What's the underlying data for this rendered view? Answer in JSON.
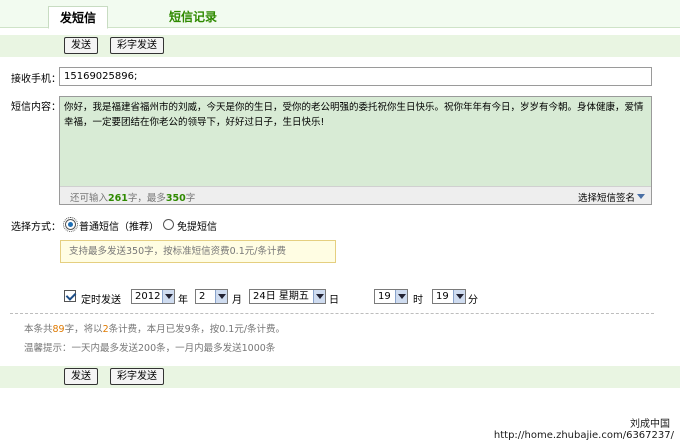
{
  "tabs": [
    {
      "label": "发短信",
      "active": true
    },
    {
      "label": "短信记录",
      "active": false
    }
  ],
  "toolbar": {
    "send_label": "发送",
    "color_send_label": "彩字发送"
  },
  "recipient": {
    "label": "接收手机：",
    "value": "15169025896;"
  },
  "message": {
    "label": "短信内容：",
    "text": "你好，我是福建省福州市的刘威，今天是你的生日，受你的老公明强的委托祝你生日快乐。祝你年年有今日，岁岁有今朝。身体健康，爱情幸福，一定要团结在你老公的领导下，好好过日子，生日快乐!",
    "count_prefix": "还可输入",
    "remaining": "261",
    "count_mid": "字，最多",
    "max": "350",
    "count_suffix": "字",
    "signature_label": "选择短信签名"
  },
  "send_mode": {
    "label": "选择方式：",
    "options": [
      {
        "label": "普通短信（推荐）",
        "selected": true
      },
      {
        "label": "免提短信",
        "selected": false
      }
    ],
    "tip": "支持最多发送350字，按标准短信资费0.1元/条计费"
  },
  "schedule": {
    "checked": true,
    "label": "定时发送",
    "year": "2012",
    "year_unit": "年",
    "month": "2",
    "month_unit": "月",
    "day": "24日 星期五",
    "day_unit": "日",
    "hour": "19",
    "hour_unit": "时",
    "minute": "19",
    "minute_unit": "分"
  },
  "info": {
    "p1": "本条共",
    "chars": "89",
    "p2": "字，将以",
    "parts": "2",
    "p3": "条计费，本月已发9条，按0.1元/条计费。",
    "reminder": "温馨提示：一天内最多发送200条，一月内最多发送1000条"
  },
  "watermark": {
    "name": "刘成中国",
    "url": "http://home.zhubajie.com/6367237/"
  },
  "colors": {
    "accent_green": "#2f8a00",
    "bar_green": "#e9f5e2",
    "message_bg": "#d8ebd5",
    "tip_border": "#e5cf80",
    "highlight": "#e07a00"
  }
}
